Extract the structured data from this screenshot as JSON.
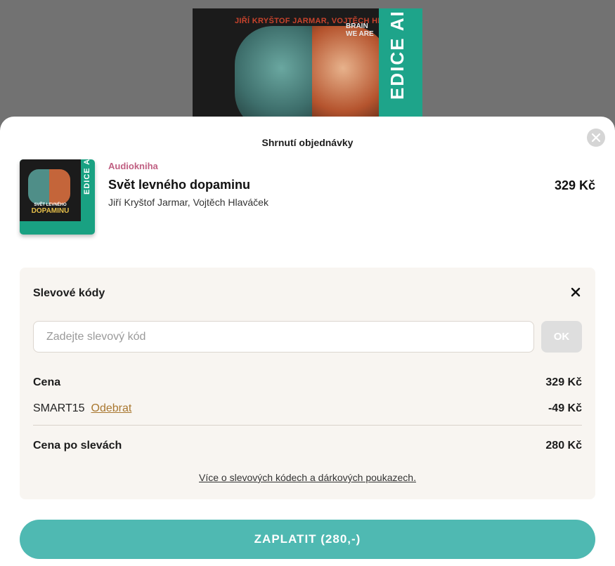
{
  "background_cover": {
    "authors_line": "JIŘÍ KRYŠTOF JARMAR, VOJTĚCH HLAVÁČEK",
    "brand_lines": [
      "BRAIN",
      "WE ARE"
    ],
    "band_text": "EDICE AI"
  },
  "sheet": {
    "title": "Shrnutí objednávky",
    "close_icon": "close-icon"
  },
  "product": {
    "type": "Audiokniha",
    "title": "Svět levného dopaminu",
    "authors": "Jiří Kryštof Jarmar, Vojtěch Hlaváček",
    "price": "329 Kč",
    "cover": {
      "small_caption": "SVĚT LEVNÉHO",
      "big_caption": "DOPAMINU",
      "band_text": "EDICE AI"
    }
  },
  "discount": {
    "title": "Slevové kódy",
    "input_placeholder": "Zadejte slevový kód",
    "input_value": "",
    "ok_label": "OK",
    "price_label": "Cena",
    "price_value": "329 Kč",
    "code_name": "SMART15",
    "remove_label": "Odebrat",
    "code_value": "-49 Kč",
    "total_label": "Cena po slevách",
    "total_value": "280 Kč",
    "info_link": "Více o slevových kódech a dárkových poukazech."
  },
  "pay_button": {
    "label": "ZAPLATIT (280,-)"
  },
  "colors": {
    "accent": "#4fb9b2",
    "product_type": "#c05f82",
    "remove_link": "#a9772f",
    "box_bg": "#f8f5f1"
  }
}
